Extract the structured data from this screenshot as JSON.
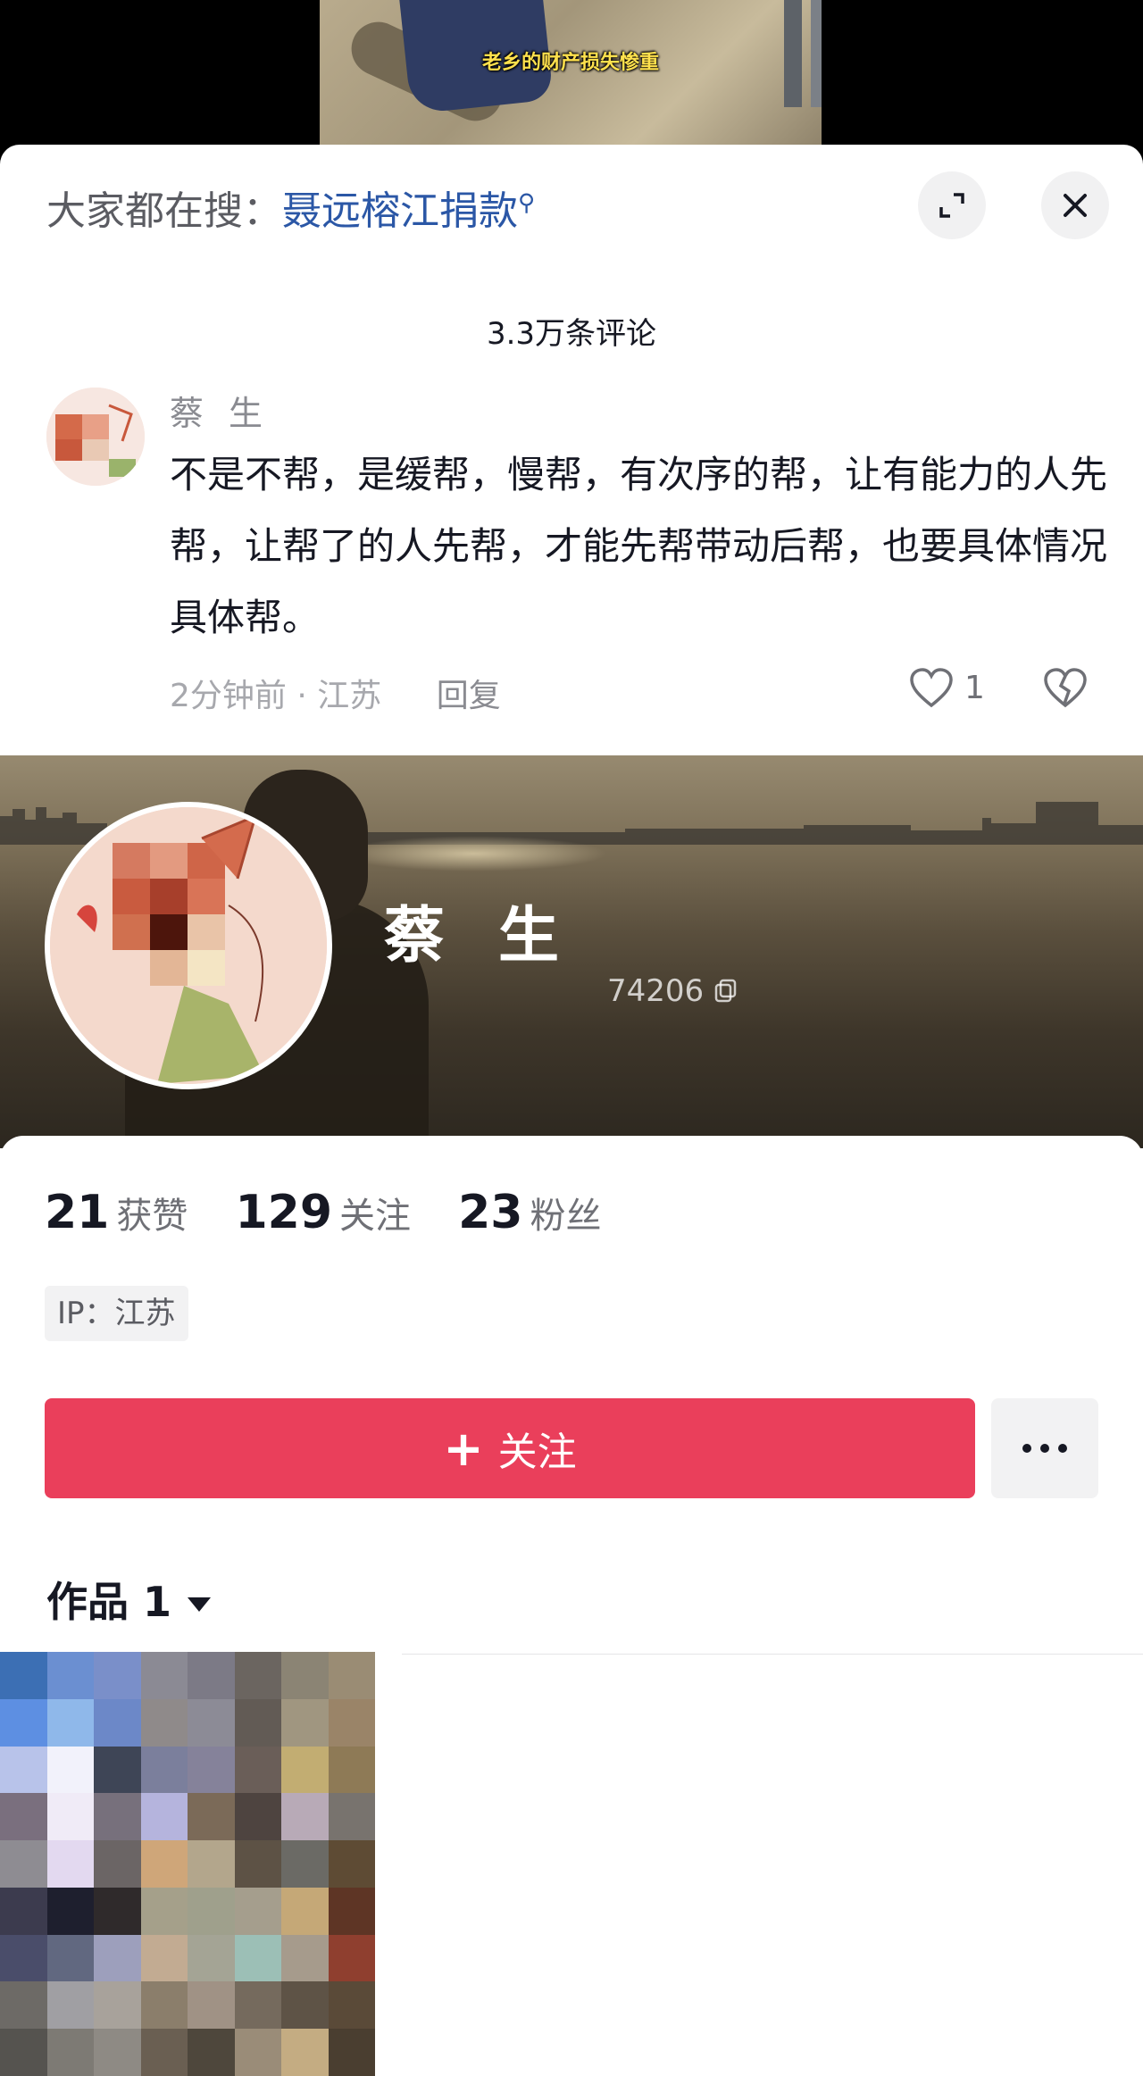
{
  "video": {
    "caption": "老乡的财产损失惨重"
  },
  "search": {
    "prefix": "大家都在搜：",
    "keyword": "聂远榕江捐款"
  },
  "comments_header": {
    "count_text": "3.3万条评论"
  },
  "comment": {
    "author": "蔡生",
    "text": "不是不帮，是缓帮，慢帮，有次序的帮，让有能力的人先帮，让帮了的人先帮，才能先帮带动后帮，也要具体情况具体帮。",
    "time": "2分钟前",
    "location": "江苏",
    "reply_label": "回复",
    "likes": "1"
  },
  "profile": {
    "name": "蔡生",
    "id_suffix": "74206",
    "stats": [
      {
        "num": "21",
        "label": "获赞"
      },
      {
        "num": "129",
        "label": "关注"
      },
      {
        "num": "23",
        "label": "粉丝"
      }
    ],
    "ip_label": "IP：江苏",
    "follow_label": "关注",
    "works_label": "作品 1"
  },
  "colors": {
    "accent": "#ea3f5b",
    "link": "#2b57a6"
  }
}
